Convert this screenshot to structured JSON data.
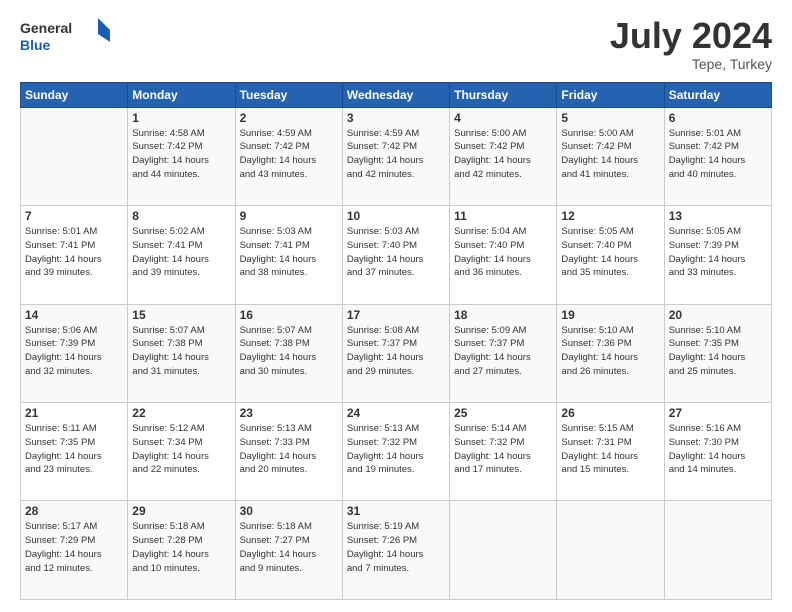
{
  "header": {
    "logo_text_general": "General",
    "logo_text_blue": "Blue",
    "month_year": "July 2024",
    "location": "Tepe, Turkey"
  },
  "weekdays": [
    "Sunday",
    "Monday",
    "Tuesday",
    "Wednesday",
    "Thursday",
    "Friday",
    "Saturday"
  ],
  "weeks": [
    [
      {
        "day": "",
        "info": ""
      },
      {
        "day": "1",
        "info": "Sunrise: 4:58 AM\nSunset: 7:42 PM\nDaylight: 14 hours\nand 44 minutes."
      },
      {
        "day": "2",
        "info": "Sunrise: 4:59 AM\nSunset: 7:42 PM\nDaylight: 14 hours\nand 43 minutes."
      },
      {
        "day": "3",
        "info": "Sunrise: 4:59 AM\nSunset: 7:42 PM\nDaylight: 14 hours\nand 42 minutes."
      },
      {
        "day": "4",
        "info": "Sunrise: 5:00 AM\nSunset: 7:42 PM\nDaylight: 14 hours\nand 42 minutes."
      },
      {
        "day": "5",
        "info": "Sunrise: 5:00 AM\nSunset: 7:42 PM\nDaylight: 14 hours\nand 41 minutes."
      },
      {
        "day": "6",
        "info": "Sunrise: 5:01 AM\nSunset: 7:42 PM\nDaylight: 14 hours\nand 40 minutes."
      }
    ],
    [
      {
        "day": "7",
        "info": "Sunrise: 5:01 AM\nSunset: 7:41 PM\nDaylight: 14 hours\nand 39 minutes."
      },
      {
        "day": "8",
        "info": "Sunrise: 5:02 AM\nSunset: 7:41 PM\nDaylight: 14 hours\nand 39 minutes."
      },
      {
        "day": "9",
        "info": "Sunrise: 5:03 AM\nSunset: 7:41 PM\nDaylight: 14 hours\nand 38 minutes."
      },
      {
        "day": "10",
        "info": "Sunrise: 5:03 AM\nSunset: 7:40 PM\nDaylight: 14 hours\nand 37 minutes."
      },
      {
        "day": "11",
        "info": "Sunrise: 5:04 AM\nSunset: 7:40 PM\nDaylight: 14 hours\nand 36 minutes."
      },
      {
        "day": "12",
        "info": "Sunrise: 5:05 AM\nSunset: 7:40 PM\nDaylight: 14 hours\nand 35 minutes."
      },
      {
        "day": "13",
        "info": "Sunrise: 5:05 AM\nSunset: 7:39 PM\nDaylight: 14 hours\nand 33 minutes."
      }
    ],
    [
      {
        "day": "14",
        "info": "Sunrise: 5:06 AM\nSunset: 7:39 PM\nDaylight: 14 hours\nand 32 minutes."
      },
      {
        "day": "15",
        "info": "Sunrise: 5:07 AM\nSunset: 7:38 PM\nDaylight: 14 hours\nand 31 minutes."
      },
      {
        "day": "16",
        "info": "Sunrise: 5:07 AM\nSunset: 7:38 PM\nDaylight: 14 hours\nand 30 minutes."
      },
      {
        "day": "17",
        "info": "Sunrise: 5:08 AM\nSunset: 7:37 PM\nDaylight: 14 hours\nand 29 minutes."
      },
      {
        "day": "18",
        "info": "Sunrise: 5:09 AM\nSunset: 7:37 PM\nDaylight: 14 hours\nand 27 minutes."
      },
      {
        "day": "19",
        "info": "Sunrise: 5:10 AM\nSunset: 7:36 PM\nDaylight: 14 hours\nand 26 minutes."
      },
      {
        "day": "20",
        "info": "Sunrise: 5:10 AM\nSunset: 7:35 PM\nDaylight: 14 hours\nand 25 minutes."
      }
    ],
    [
      {
        "day": "21",
        "info": "Sunrise: 5:11 AM\nSunset: 7:35 PM\nDaylight: 14 hours\nand 23 minutes."
      },
      {
        "day": "22",
        "info": "Sunrise: 5:12 AM\nSunset: 7:34 PM\nDaylight: 14 hours\nand 22 minutes."
      },
      {
        "day": "23",
        "info": "Sunrise: 5:13 AM\nSunset: 7:33 PM\nDaylight: 14 hours\nand 20 minutes."
      },
      {
        "day": "24",
        "info": "Sunrise: 5:13 AM\nSunset: 7:32 PM\nDaylight: 14 hours\nand 19 minutes."
      },
      {
        "day": "25",
        "info": "Sunrise: 5:14 AM\nSunset: 7:32 PM\nDaylight: 14 hours\nand 17 minutes."
      },
      {
        "day": "26",
        "info": "Sunrise: 5:15 AM\nSunset: 7:31 PM\nDaylight: 14 hours\nand 15 minutes."
      },
      {
        "day": "27",
        "info": "Sunrise: 5:16 AM\nSunset: 7:30 PM\nDaylight: 14 hours\nand 14 minutes."
      }
    ],
    [
      {
        "day": "28",
        "info": "Sunrise: 5:17 AM\nSunset: 7:29 PM\nDaylight: 14 hours\nand 12 minutes."
      },
      {
        "day": "29",
        "info": "Sunrise: 5:18 AM\nSunset: 7:28 PM\nDaylight: 14 hours\nand 10 minutes."
      },
      {
        "day": "30",
        "info": "Sunrise: 5:18 AM\nSunset: 7:27 PM\nDaylight: 14 hours\nand 9 minutes."
      },
      {
        "day": "31",
        "info": "Sunrise: 5:19 AM\nSunset: 7:26 PM\nDaylight: 14 hours\nand 7 minutes."
      },
      {
        "day": "",
        "info": ""
      },
      {
        "day": "",
        "info": ""
      },
      {
        "day": "",
        "info": ""
      }
    ]
  ]
}
